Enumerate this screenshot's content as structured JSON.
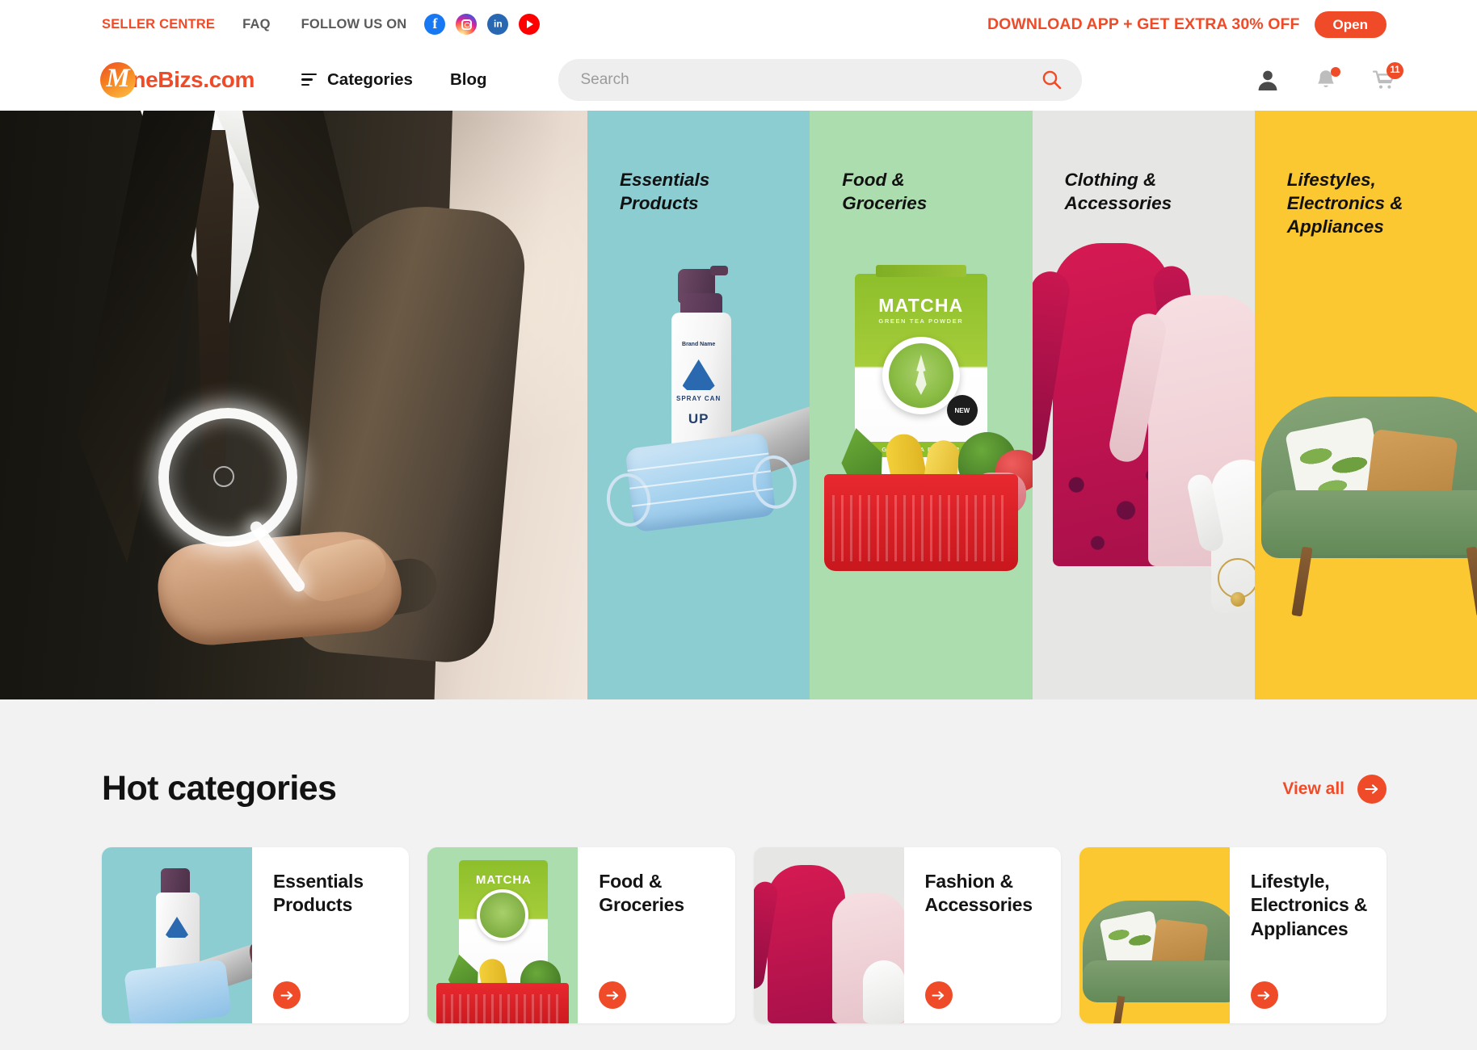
{
  "topbar": {
    "seller_centre": "SELLER CENTRE",
    "faq": "FAQ",
    "follow_us": "FOLLOW US ON",
    "socials": [
      "facebook-icon",
      "instagram-icon",
      "linkedin-icon",
      "youtube-icon"
    ],
    "promo": "DOWNLOAD APP + GET EXTRA 30% OFF",
    "open_button": "Open"
  },
  "header": {
    "logo_mark_letter": "M",
    "logo_text": "ineBizs.com",
    "nav": [
      {
        "label": "Categories",
        "icon": "hamburger-icon"
      },
      {
        "label": "Blog",
        "icon": ""
      }
    ],
    "search": {
      "placeholder": "Search",
      "value": "",
      "icon": "search-icon"
    },
    "icons": [
      {
        "name": "account-icon",
        "badge": ""
      },
      {
        "name": "notifications-icon",
        "badge": "dot"
      },
      {
        "name": "cart-icon",
        "badge": "11"
      }
    ]
  },
  "hero": {
    "main_image_alt": "businessman-holding-magnifying-glass",
    "panels": [
      {
        "label": "Essentials\nProducts",
        "color": "#8ccdd2"
      },
      {
        "label": "Food &\nGroceries",
        "color": "#acddae"
      },
      {
        "label": "Clothing &\nAccessories",
        "color": "#e6e6e4"
      },
      {
        "label": "Lifestyles,\nElectronics &\nAppliances",
        "color": "#fbc832"
      }
    ]
  },
  "hot_categories": {
    "title": "Hot categories",
    "view_all": "View all",
    "cards": [
      {
        "title": "Essentials\nProducts",
        "color": "#8ccdd2",
        "arrow": "arrow-right-icon"
      },
      {
        "title": "Food &\nGroceries",
        "color": "#acddae",
        "arrow": "arrow-right-icon"
      },
      {
        "title": "Fashion &\nAccessories",
        "color": "#e6e6e4",
        "arrow": "arrow-right-icon"
      },
      {
        "title": "Lifestyle,\nElectronics &\nAppliances",
        "color": "#fbc832",
        "arrow": "arrow-right-icon"
      }
    ]
  },
  "product_art": {
    "spray_brand": "Brand Name",
    "spray_label": "SPRAY CAN",
    "spray_word": "UP",
    "matcha_word": "MATCHA",
    "matcha_sub": "GREEN TEA POWDER",
    "matcha_band": "GREEN TEA POWDER",
    "matcha_badge": "NEW",
    "mini_matcha_word": "MATCHA"
  },
  "colors": {
    "accent": "#ef4b28",
    "page_bg": "#f2f2f2",
    "text_dark": "#141414"
  }
}
